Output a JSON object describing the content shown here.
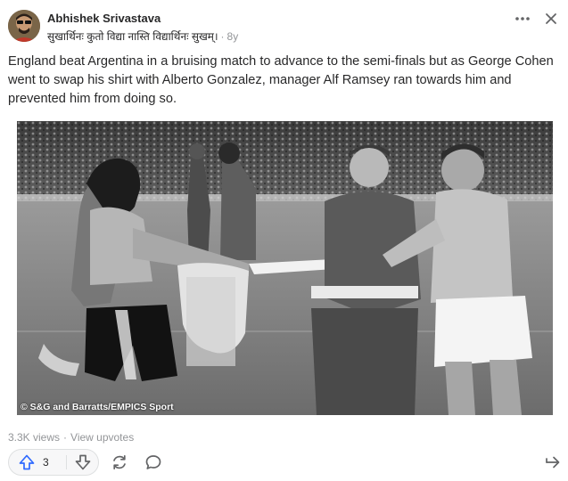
{
  "post": {
    "author": "Abhishek Srivastava",
    "tagline": "सुखार्थिनः कुतो विद्या नास्ति विद्यार्थिनः सुखम्।",
    "separator": "·",
    "age": "8y",
    "text": "England beat Argentina in a bruising match to advance to the semi-finals but as George Cohen went to swap his shirt with Alberto Gonzalez, manager Alf Ramsey ran towards him and prevented him from doing so.",
    "image_credit": "© S&G and Barratts/EMPICS Sport"
  },
  "header": {
    "more_icon": "ellipsis-icon",
    "close_icon": "close-icon"
  },
  "footer": {
    "views": "3.3K views",
    "dot": "·",
    "view_upvotes": "View upvotes",
    "upvote_count": "3",
    "icons": [
      "upvote-icon",
      "downvote-icon",
      "share-reshare-icon",
      "comment-icon",
      "share-icon"
    ]
  },
  "colors": {
    "text": "#282829",
    "muted": "#939598",
    "upvote_blue": "#2e69ff",
    "border": "#dee0e1"
  }
}
